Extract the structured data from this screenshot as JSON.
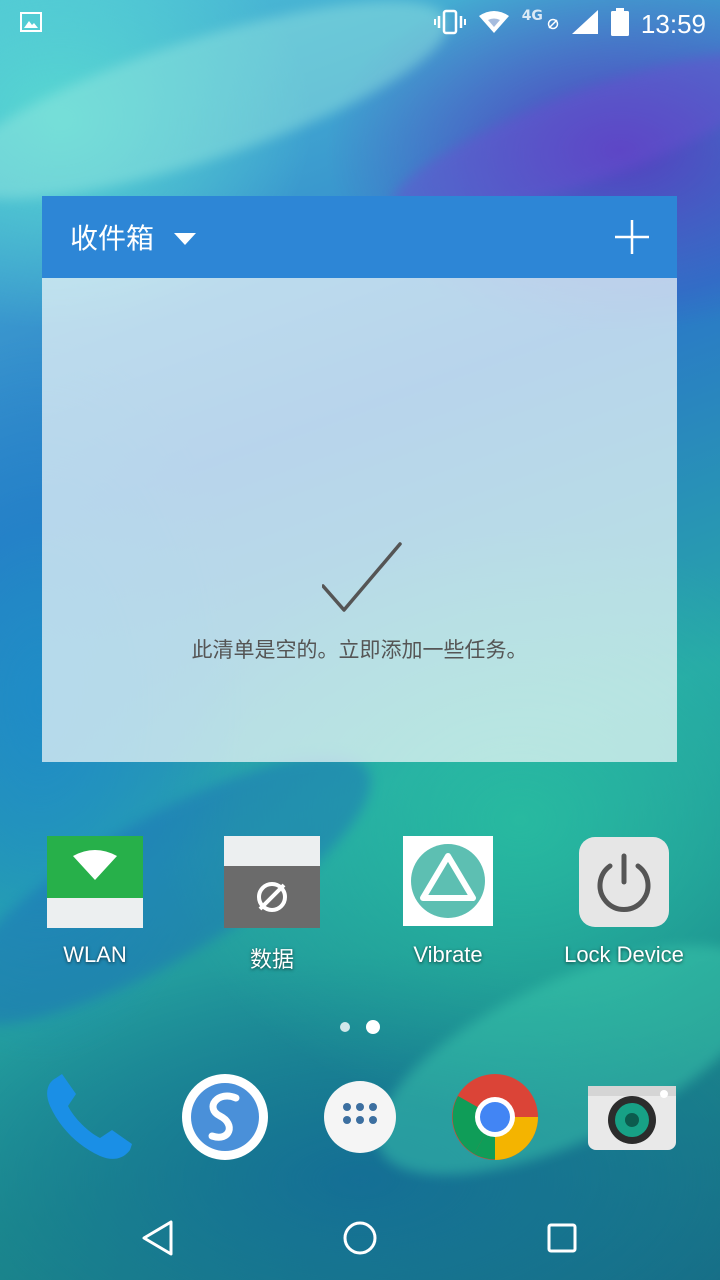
{
  "status_bar": {
    "time": "13:59",
    "network_type": "4G",
    "icons": [
      "image-notification-icon",
      "vibrate-icon",
      "wifi-icon",
      "signal-icon",
      "battery-icon"
    ]
  },
  "widget": {
    "title": "收件箱",
    "empty_message": "此清单是空的。立即添加一些任务。",
    "header_color": "#2d86d6"
  },
  "apps": [
    {
      "label": "WLAN",
      "icon": "wifi-toggle-icon"
    },
    {
      "label": "数据",
      "icon": "mobile-data-off-icon"
    },
    {
      "label": "Vibrate",
      "icon": "triangle-icon"
    },
    {
      "label": "Lock Device",
      "icon": "power-icon"
    }
  ],
  "page_indicator": {
    "pages": 2,
    "current": 2
  },
  "dock": [
    "phone-icon",
    "simplenote-icon",
    "app-drawer-icon",
    "chrome-icon",
    "camera-icon"
  ],
  "nav": [
    "back-icon",
    "home-icon",
    "recents-icon"
  ]
}
